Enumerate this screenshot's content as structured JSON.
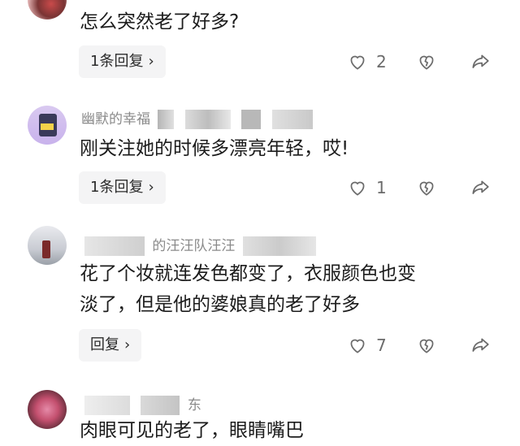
{
  "comments": [
    {
      "text": "怎么突然老了好多?",
      "reply_label": "1条回复",
      "likes": "2"
    },
    {
      "username_fragment": "幽默的幸福",
      "text": "刚关注她的时候多漂亮年轻，哎!",
      "reply_label": "1条回复",
      "likes": "1"
    },
    {
      "username_fragment": "的汪汪队汪汪",
      "text_line1": "花了个妆就连发色都变了，衣服颜色也变",
      "text_line2": "淡了，但是他的婆娘真的老了好多",
      "reply_label": "回复",
      "likes": "7"
    },
    {
      "username_fragment": "东",
      "text": "肉眼可见的老了，眼睛嘴巴"
    }
  ],
  "icons": {
    "like": "heart-outline-icon",
    "dislike": "broken-heart-icon",
    "share": "share-arrow-icon",
    "chevron": "chevron-right-icon"
  },
  "colors": {
    "reply_bg": "#f4f4f5",
    "meta_text": "#8a8a8a",
    "icon": "#6b6b6b"
  }
}
